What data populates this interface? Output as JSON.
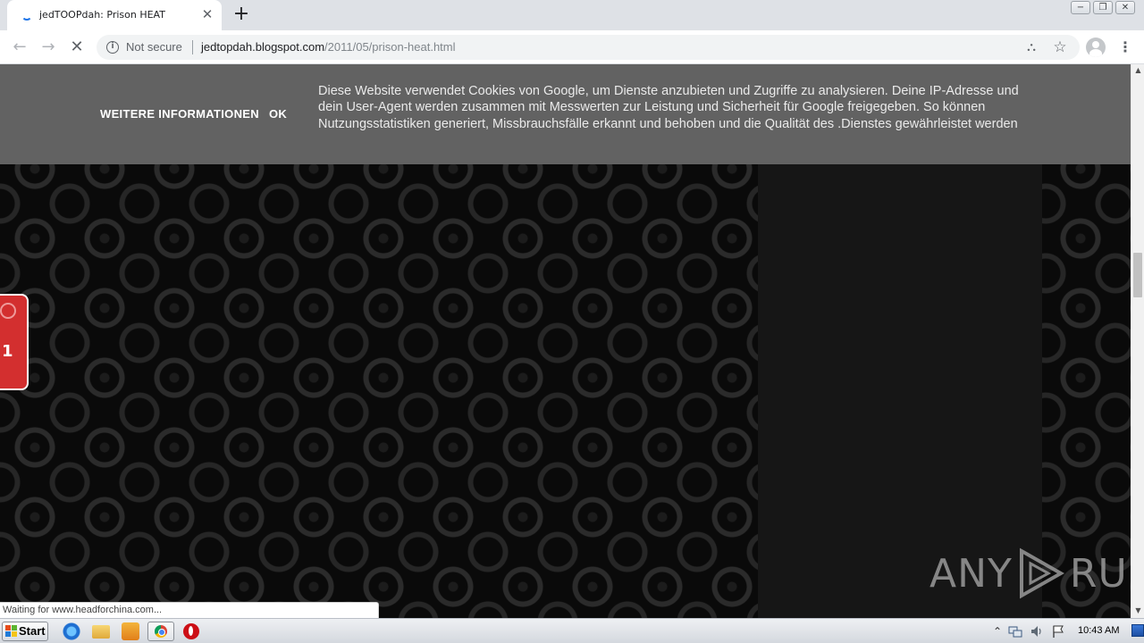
{
  "browser": {
    "tab": {
      "title": "jedTOOPdah: Prison HEAT",
      "close_glyph": "✕",
      "loading": true
    },
    "new_tab_glyph": "+",
    "window_controls": {
      "minimize": "−",
      "restore": "❐",
      "close": "✕"
    },
    "toolbar": {
      "back_glyph": "←",
      "forward_glyph": "→",
      "stop_glyph": "✕",
      "security_label": "Not secure",
      "url_host": "jedtopdah.blogspot.com",
      "url_path": "/2011/05/prison-heat.html",
      "translate_glyph": "⛬",
      "star_glyph": "☆",
      "menu_glyph": "⋮"
    }
  },
  "page": {
    "cookie_bar": {
      "more_info_label": "WEITERE INFORMATIONEN",
      "ok_label": "OK",
      "message": "Diese Website verwendet Cookies von Google, um Dienste anzubieten und Zugriffe zu analysieren. Deine IP-Adresse und dein User-Agent werden zusammen mit Messwerten zur Leistung und Sicherheit für Google freigegeben. So können Nutzungsstatistiken generiert, Missbrauchsfälle erkannt und behoben und die Qualität des .Dienstes gewährleistet werden"
    },
    "floating_badge": {
      "number": "1"
    },
    "watermark": {
      "left": "ANY",
      "right": "RUN"
    }
  },
  "status_bar": {
    "text": "Waiting for www.headforchina.com..."
  },
  "scrollbar": {
    "up_glyph": "▲",
    "down_glyph": "▼"
  },
  "taskbar": {
    "start_label": "Start",
    "tray": {
      "expand_glyph": "⌃",
      "clock": "10:43 AM"
    }
  },
  "colors": {
    "cookie_bar_bg": "#626262",
    "badge_red": "#d32f2f",
    "page_bg": "#0a0a0a"
  }
}
